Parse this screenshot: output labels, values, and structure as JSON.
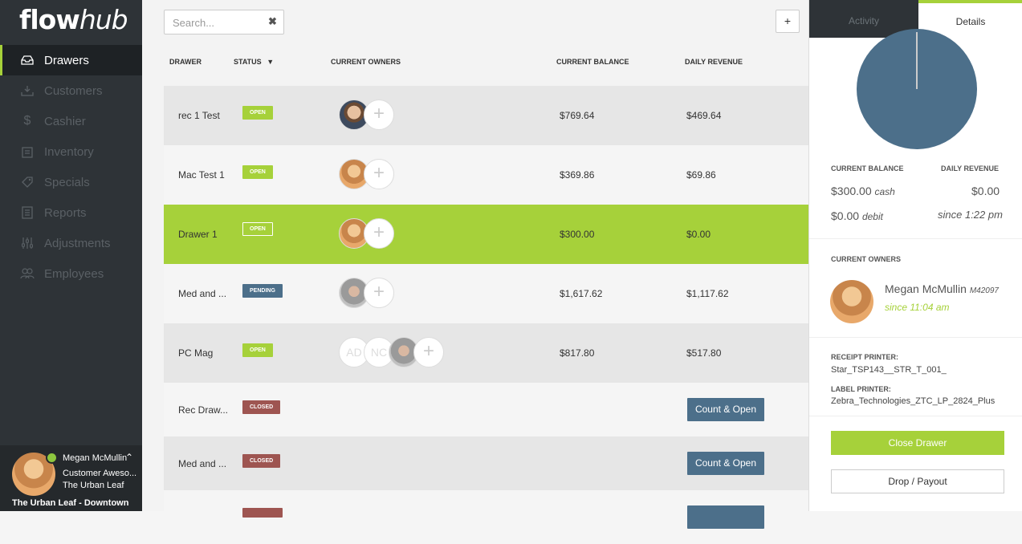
{
  "app": {
    "logo_bold": "flow",
    "logo_italic": "hub"
  },
  "nav": [
    {
      "label": "Drawers",
      "icon": "drawer-icon",
      "active": true
    },
    {
      "label": "Customers",
      "icon": "customers-icon"
    },
    {
      "label": "Cashier",
      "icon": "dollar-icon"
    },
    {
      "label": "Inventory",
      "icon": "inventory-icon"
    },
    {
      "label": "Specials",
      "icon": "tag-icon"
    },
    {
      "label": "Reports",
      "icon": "reports-icon"
    },
    {
      "label": "Adjustments",
      "icon": "sliders-icon"
    },
    {
      "label": "Employees",
      "icon": "employees-icon"
    }
  ],
  "user": {
    "name": "Megan McMullin",
    "role": "Customer Aweso...",
    "store": "The Urban Leaf",
    "location": "The Urban Leaf - Downtown"
  },
  "toolbar": {
    "search_placeholder": "Search...",
    "clear": "✖",
    "add": "+"
  },
  "table": {
    "headers": {
      "drawer": "DRAWER",
      "status": "STATUS",
      "owners": "CURRENT OWNERS",
      "balance": "CURRENT BALANCE",
      "revenue": "DAILY REVENUE"
    },
    "rows": [
      {
        "name": "rec 1 Test",
        "status": "OPEN",
        "balance": "$769.64",
        "revenue": "$469.64"
      },
      {
        "name": "Mac Test 1",
        "status": "OPEN",
        "balance": "$369.86",
        "revenue": "$69.86"
      },
      {
        "name": "Drawer 1",
        "status": "OPEN",
        "balance": "$300.00",
        "revenue": "$0.00"
      },
      {
        "name": "Med and ...",
        "status": "PENDING",
        "balance": "$1,617.62",
        "revenue": "$1,117.62"
      },
      {
        "name": "PC Mag",
        "status": "OPEN",
        "balance": "$817.80",
        "revenue": "$517.80",
        "initials": [
          "AD",
          "NC"
        ]
      },
      {
        "name": "Rec Draw...",
        "status": "CLOSED",
        "action": "Count & Open"
      },
      {
        "name": "Med and ...",
        "status": "CLOSED",
        "action": "Count & Open"
      }
    ]
  },
  "panel": {
    "tabs": {
      "activity": "Activity",
      "details": "Details"
    },
    "balance_label": "CURRENT BALANCE",
    "revenue_label": "DAILY REVENUE",
    "cash_amount": "$300.00",
    "cash_unit": "cash",
    "debit_amount": "$0.00",
    "debit_unit": "debit",
    "revenue_value": "$0.00",
    "since": "since 1:22 pm",
    "owners_label": "CURRENT OWNERS",
    "owner_name": "Megan McMullin",
    "owner_id": "M42097",
    "owner_since": "since 11:04 am",
    "receipt_label": "RECEIPT PRINTER:",
    "receipt_value": "Star_TSP143__STR_T_001_",
    "label_label": "LABEL PRINTER:",
    "label_value": "Zebra_Technologies_ZTC_LP_2824_Plus",
    "close_btn": "Close Drawer",
    "drop_btn": "Drop / Payout"
  },
  "colors": {
    "accent": "#a6d13a",
    "sidebar": "#2e3337",
    "blue": "#4c6f8a",
    "closed": "#9e5551"
  }
}
